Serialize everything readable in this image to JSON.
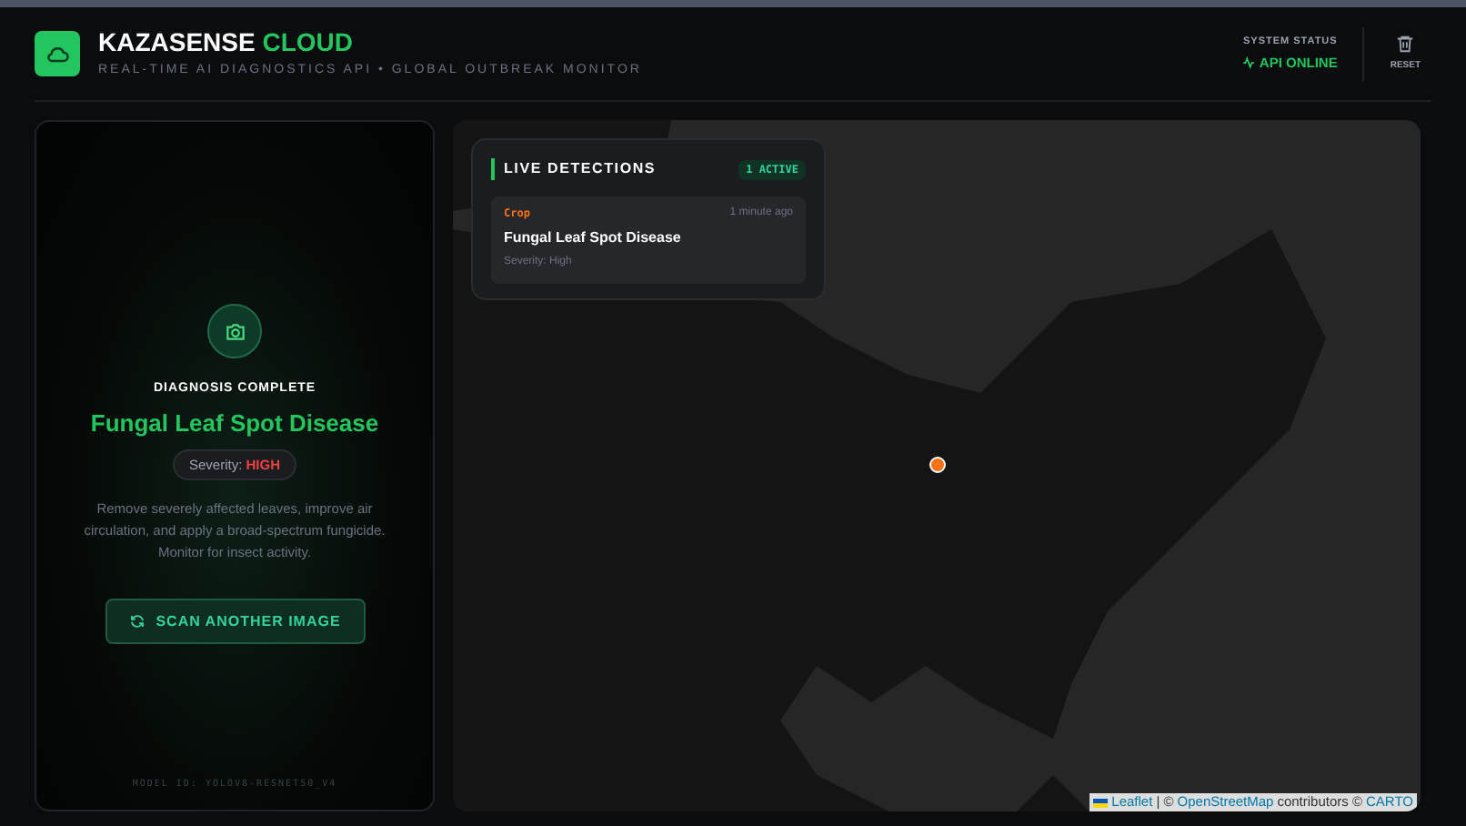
{
  "header": {
    "brand": "KAZASENSE",
    "brand_accent": "CLOUD",
    "subtitle": "REAL-TIME AI DIAGNOSTICS API • GLOBAL OUTBREAK MONITOR",
    "status_label": "SYSTEM STATUS",
    "status": "API ONLINE",
    "online": true,
    "reset": "RESET"
  },
  "result": {
    "heading": "DIAGNOSIS COMPLETE",
    "disease": "Fungal Leaf Spot Disease",
    "severity_label": "Severity:",
    "severity": "HIGH",
    "advice": "Remove severely affected leaves, improve air circulation, and apply a broad-spectrum fungicide. Monitor for insect activity.",
    "button": "SCAN ANOTHER IMAGE",
    "model": "MODEL ID: YOLOV8-RESNET50_V4"
  },
  "detections": {
    "title": "LIVE DETECTIONS",
    "badge": "1 ACTIVE",
    "items": [
      {
        "type": "Crop",
        "time": "1 minute ago",
        "name": "Fungal Leaf Spot Disease",
        "severity": "Severity: High",
        "color": "#f97316"
      }
    ]
  },
  "map": {
    "attribution_leaflet": "Leaflet",
    "attribution_rest": "| ©",
    "attribution_osm": "OpenStreetMap",
    "attribution_contrib": "contributors ©",
    "attribution_carto": "CARTO"
  }
}
